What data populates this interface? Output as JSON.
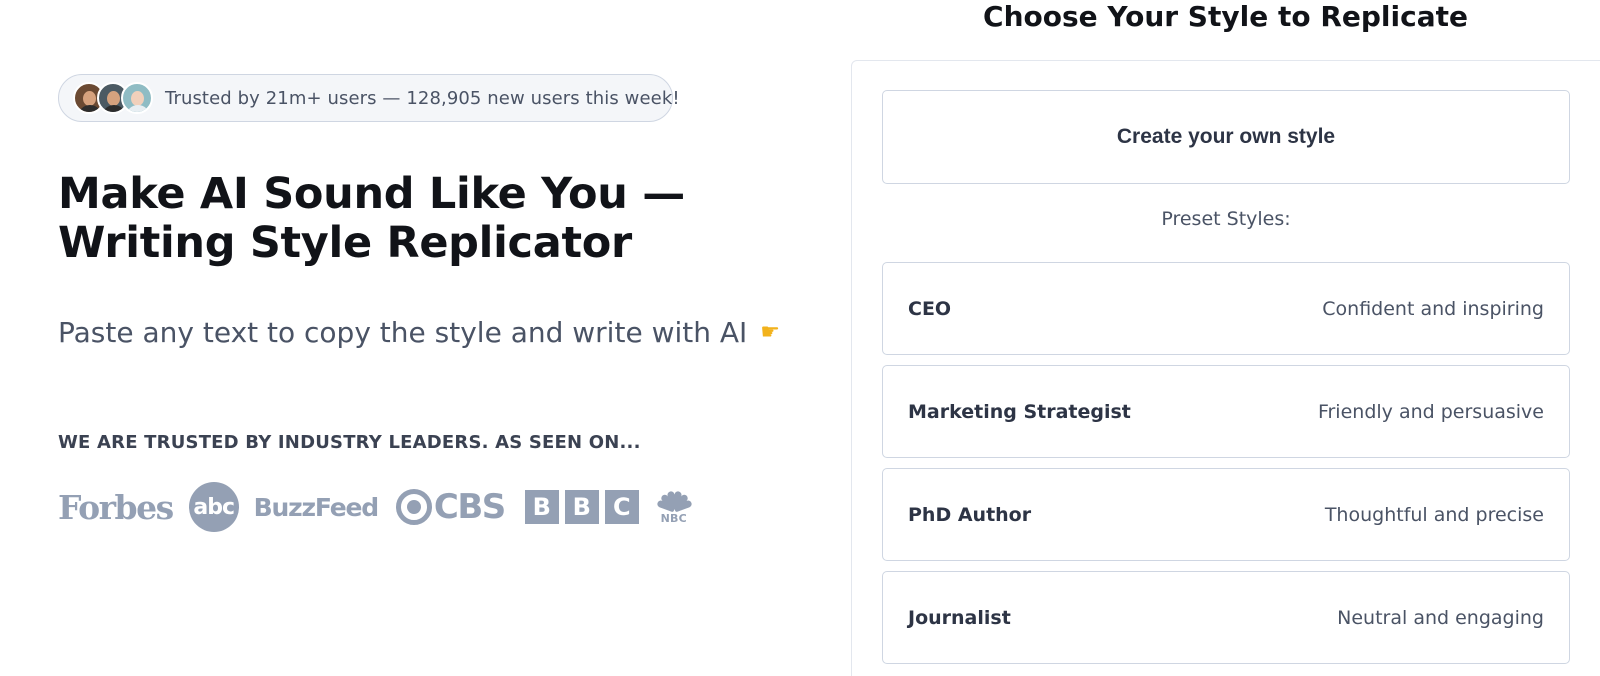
{
  "hero": {
    "trust_text": "Trusted by 21m+ users — 128,905 new users this week!",
    "headline": "Make AI Sound Like You — Writing Style Replicator",
    "subheadline": "Paste any text to copy the style and write with AI",
    "pointer_icon": "pointing-right-icon",
    "avatars": [
      "user-avatar",
      "user-avatar",
      "user-avatar"
    ]
  },
  "seen_on": {
    "heading": "WE ARE TRUSTED BY INDUSTRY LEADERS. AS SEEN ON...",
    "logos": {
      "forbes": "Forbes",
      "abc": "abc",
      "buzzfeed": "BuzzFeed",
      "cbs": "CBS",
      "bbc": [
        "B",
        "B",
        "C"
      ],
      "nbc": "NBC"
    }
  },
  "style_panel": {
    "title": "Choose Your Style to Replicate",
    "create_label": "Create your own style",
    "preset_label": "Preset Styles:",
    "presets": [
      {
        "name": "CEO",
        "description": "Confident and inspiring"
      },
      {
        "name": "Marketing Strategist",
        "description": "Friendly and persuasive"
      },
      {
        "name": "PhD Author",
        "description": "Thoughtful and precise"
      },
      {
        "name": "Journalist",
        "description": "Neutral and engaging"
      }
    ]
  },
  "colors": {
    "logo_gray": "#94a0b4",
    "text_dark": "#111318",
    "text_muted": "#4a5365",
    "border": "#cfd6e2"
  }
}
